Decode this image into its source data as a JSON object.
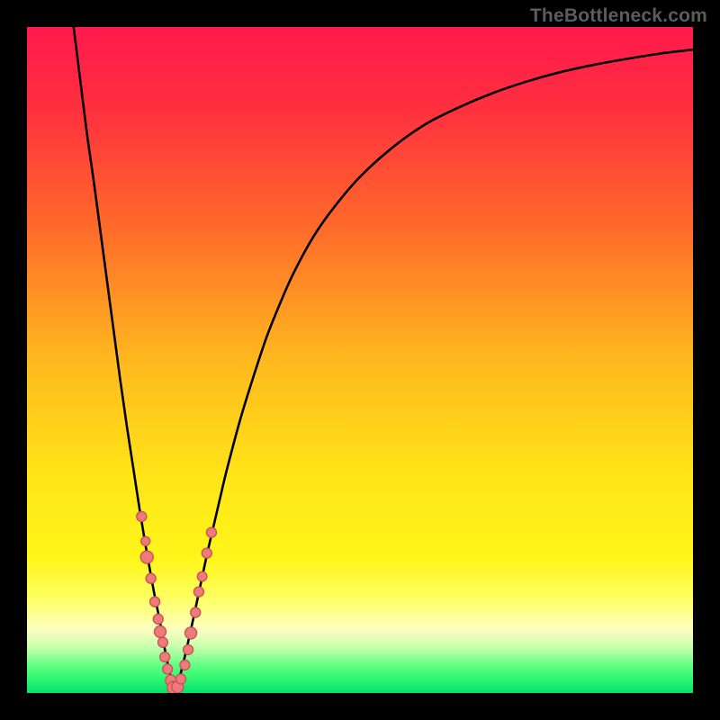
{
  "watermark": "TheBottleneck.com",
  "colors": {
    "gradient_stops": [
      {
        "offset": 0.0,
        "color": "#ff1a4d"
      },
      {
        "offset": 0.12,
        "color": "#ff2f3f"
      },
      {
        "offset": 0.3,
        "color": "#ff6a2a"
      },
      {
        "offset": 0.5,
        "color": "#ffb81f"
      },
      {
        "offset": 0.68,
        "color": "#ffe617"
      },
      {
        "offset": 0.8,
        "color": "#fff61a"
      },
      {
        "offset": 0.86,
        "color": "#ffff66"
      },
      {
        "offset": 0.905,
        "color": "#fcffc0"
      },
      {
        "offset": 0.93,
        "color": "#c9ffad"
      },
      {
        "offset": 0.965,
        "color": "#4eff7a"
      },
      {
        "offset": 1.0,
        "color": "#00e56a"
      }
    ],
    "curve": "#000000",
    "dot_fill": "#ee7a7b",
    "dot_stroke": "#c95457",
    "frame": "#000000"
  },
  "chart_data": {
    "type": "line",
    "title": "",
    "xlabel": "",
    "ylabel": "",
    "xlim": [
      0,
      100
    ],
    "ylim": [
      0,
      100
    ],
    "grid": false,
    "series": [
      {
        "name": "bottleneck-curve",
        "x": [
          7,
          8,
          9,
          10,
          11,
          12,
          13,
          14,
          15,
          16,
          17,
          18,
          19,
          20,
          20.8,
          21.5,
          22,
          23,
          24,
          25,
          26,
          27,
          28,
          29,
          30,
          32,
          34,
          36,
          38,
          40,
          43,
          46,
          50,
          55,
          60,
          65,
          70,
          75,
          80,
          85,
          90,
          95,
          100
        ],
        "y": [
          100,
          92,
          84,
          77,
          69.5,
          62,
          54.5,
          47,
          40,
          33.5,
          27,
          21,
          15.5,
          10.5,
          6,
          2.7,
          0.6,
          2.7,
          6.8,
          11.3,
          16,
          20.7,
          25,
          29.3,
          33.5,
          41,
          47.5,
          53.5,
          58.5,
          63,
          68.5,
          72.8,
          77.5,
          82,
          85.5,
          88,
          90.1,
          91.8,
          93.2,
          94.3,
          95.2,
          96,
          96.6
        ]
      }
    ],
    "highlight_points": [
      {
        "x": 17.2,
        "y": 26.5,
        "r": 5.5
      },
      {
        "x": 17.8,
        "y": 22.8,
        "r": 5.0
      },
      {
        "x": 18.0,
        "y": 20.4,
        "r": 7.0
      },
      {
        "x": 18.6,
        "y": 17.2,
        "r": 5.5
      },
      {
        "x": 19.2,
        "y": 13.7,
        "r": 5.5
      },
      {
        "x": 19.7,
        "y": 11.1,
        "r": 5.5
      },
      {
        "x": 20.0,
        "y": 9.2,
        "r": 6.5
      },
      {
        "x": 20.4,
        "y": 7.6,
        "r": 5.5
      },
      {
        "x": 20.7,
        "y": 5.4,
        "r": 5.5
      },
      {
        "x": 21.1,
        "y": 3.6,
        "r": 5.5
      },
      {
        "x": 21.6,
        "y": 1.9,
        "r": 6.0
      },
      {
        "x": 22.0,
        "y": 0.8,
        "r": 7.0
      },
      {
        "x": 22.6,
        "y": 0.9,
        "r": 6.5
      },
      {
        "x": 23.1,
        "y": 2.1,
        "r": 5.5
      },
      {
        "x": 23.7,
        "y": 4.2,
        "r": 5.5
      },
      {
        "x": 24.2,
        "y": 6.5,
        "r": 5.5
      },
      {
        "x": 24.6,
        "y": 9.0,
        "r": 6.5
      },
      {
        "x": 25.3,
        "y": 12.1,
        "r": 5.5
      },
      {
        "x": 25.8,
        "y": 15.2,
        "r": 5.5
      },
      {
        "x": 26.3,
        "y": 17.5,
        "r": 5.3
      },
      {
        "x": 27.0,
        "y": 21.0,
        "r": 5.5
      },
      {
        "x": 27.7,
        "y": 24.1,
        "r": 5.5
      }
    ]
  }
}
